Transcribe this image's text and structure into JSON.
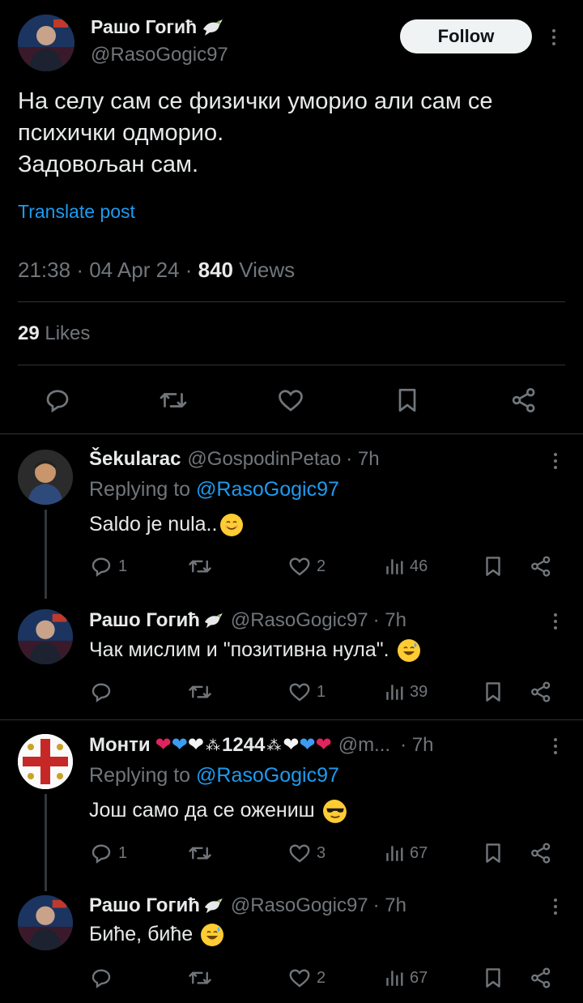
{
  "main_tweet": {
    "author_name": "Рашо Гогић",
    "author_handle": "@RasoGogic97",
    "follow_label": "Follow",
    "text_lines": [
      "На селу сам се физички уморио али сам се",
      "психички одморио.",
      "Задовољан сам."
    ],
    "translate_label": "Translate post",
    "time": "21:38",
    "date": "04 Apr 24",
    "views_count": "840",
    "views_label": "Views",
    "likes_count": "29",
    "likes_label": "Likes"
  },
  "replies": [
    {
      "author_name": "Šekularac",
      "author_handle": "@GospodinPetao",
      "time": "· 7h",
      "replying_prefix": "Replying to",
      "replying_handle": "@RasoGogic97",
      "text": "Saldo je nula..",
      "replies_count": "1",
      "retweets_count": "",
      "likes_count": "2",
      "views_count": "46"
    },
    {
      "author_name": "Рашо Гогић",
      "author_handle": "@RasoGogic97",
      "time": "· 7h",
      "text": "Чак мислим и \"позитивна нула\".",
      "replies_count": "",
      "retweets_count": "",
      "likes_count": "1",
      "views_count": "39"
    },
    {
      "author_name": "Монти",
      "name_suffix": "1244",
      "author_handle": "@m...",
      "time": "· 7h",
      "replying_prefix": "Replying to",
      "replying_handle": "@RasoGogic97",
      "text": "Још само да се ожениш",
      "replies_count": "1",
      "retweets_count": "",
      "likes_count": "3",
      "views_count": "67"
    },
    {
      "author_name": "Рашо Гогић",
      "author_handle": "@RasoGogic97",
      "time": "· 7h",
      "text": "Биће, биће",
      "replies_count": "",
      "retweets_count": "",
      "likes_count": "2",
      "views_count": "67"
    }
  ],
  "colors": {
    "background": "#000000",
    "text": "#e7e9ea",
    "muted": "#71767b",
    "link": "#1d9bf0",
    "divider": "#2f3336"
  },
  "icons": [
    "dove-icon",
    "reply-icon",
    "retweet-icon",
    "like-icon",
    "bookmark-icon",
    "share-icon",
    "views-icon",
    "more-icon"
  ]
}
